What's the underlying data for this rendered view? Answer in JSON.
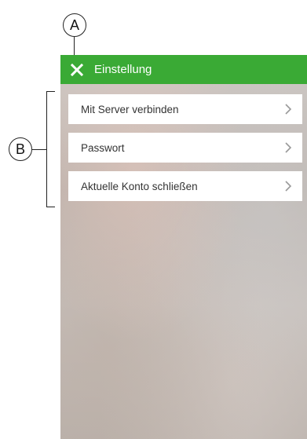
{
  "annotations": {
    "a_label": "A",
    "b_label": "B"
  },
  "header": {
    "close_icon": "close-icon",
    "title": "Einstellung",
    "background_color": "#3aaa35"
  },
  "menu": {
    "items": [
      {
        "label": "Mit Server verbinden",
        "icon": "chevron-right-icon"
      },
      {
        "label": "Passwort",
        "icon": "chevron-right-icon"
      },
      {
        "label": "Aktuelle Konto schließen",
        "icon": "chevron-right-icon"
      }
    ]
  }
}
